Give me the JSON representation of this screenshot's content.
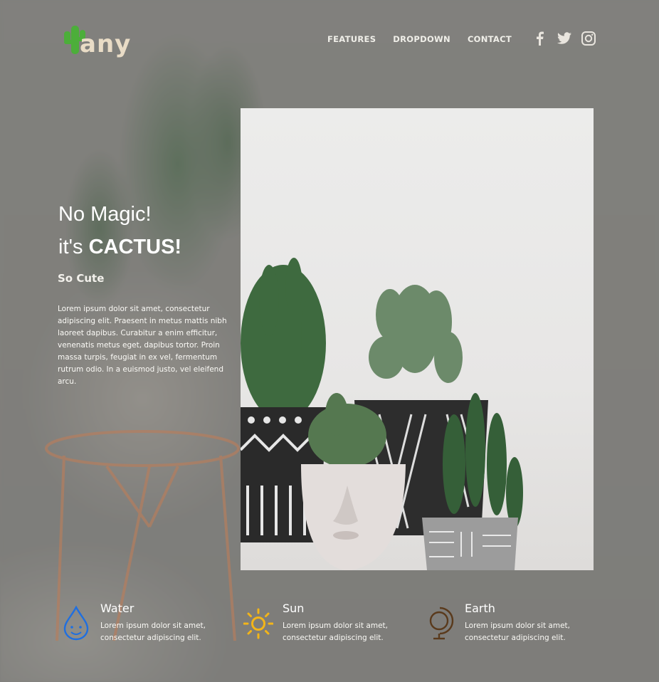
{
  "brand": {
    "name": "any"
  },
  "nav": {
    "items": [
      "FEATURES",
      "DROPDOWN",
      "CONTACT"
    ]
  },
  "social": {
    "icons": [
      "facebook-icon",
      "twitter-icon",
      "instagram-icon"
    ]
  },
  "hero": {
    "line1": "No Magic!",
    "line2_prefix": "it's ",
    "line2_strong": "CACTUS!",
    "subtitle": "So Cute",
    "paragraph": "Lorem ipsum dolor sit amet, consectetur adipiscing elit. Praesent in metus mattis nibh laoreet dapibus. Curabitur a enim efficitur, venenatis metus eget, dapibus tortor. Proin massa turpis, feugiat in ex vel, fermentum rutrum odio. In a euismod justo, vel eleifend arcu."
  },
  "features": [
    {
      "title": "Water",
      "text": "Lorem ipsum dolor sit amet, consectetur adipiscing elit.",
      "icon": "water-drop-icon",
      "color": "#1f6fe0"
    },
    {
      "title": "Sun",
      "text": "Lorem ipsum dolor sit amet, consectetur adipiscing elit.",
      "icon": "sun-icon",
      "color": "#f3b519"
    },
    {
      "title": "Earth",
      "text": "Lorem ipsum dolor sit amet, consectetur adipiscing elit.",
      "icon": "globe-icon",
      "color": "#5a3a1c"
    }
  ],
  "colors": {
    "accent_green": "#4cae3a",
    "logo_cream": "#e9dcc6"
  }
}
